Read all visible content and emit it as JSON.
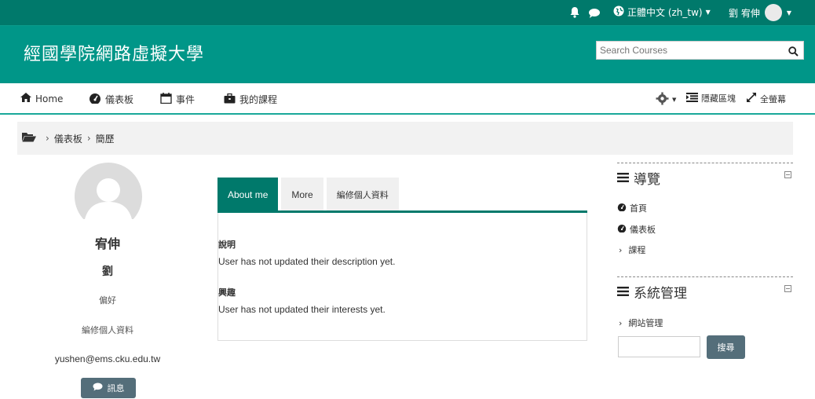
{
  "topbar": {
    "language": "正體中文 (zh_tw)",
    "user_name": "劉 宥伸"
  },
  "header": {
    "site_title": "經國學院網路虛擬大學",
    "search_placeholder": "Search Courses"
  },
  "nav": {
    "home": "Home",
    "dashboard": "儀表板",
    "events": "事件",
    "my_courses": "我的課程",
    "hide_blocks": "隱藏區塊",
    "fullscreen": "全螢幕"
  },
  "breadcrumb": {
    "items": [
      "儀表板",
      "簡歷"
    ]
  },
  "profile": {
    "first_name": "宥伸",
    "last_name": "劉",
    "preferences": "偏好",
    "edit_profile": "編修個人資料",
    "email": "yushen@ems.cku.edu.tw",
    "message_button": "訊息"
  },
  "tabs": [
    {
      "label": "About me",
      "active": true
    },
    {
      "label": "More",
      "active": false
    },
    {
      "label": "編修個人資料",
      "active": false
    }
  ],
  "about": {
    "description_title": "說明",
    "description_text": "User has not updated their description yet.",
    "interests_title": "興趣",
    "interests_text": "User has not updated their interests yet."
  },
  "navigation_block": {
    "title": "導覽",
    "items": [
      "首頁",
      "儀表板",
      "課程"
    ]
  },
  "admin_block": {
    "title": "系統管理",
    "items": [
      "網站管理"
    ],
    "search_button": "搜尋"
  },
  "colors": {
    "topbar": "#00796b",
    "header": "#009688",
    "accent": "#00796b",
    "button": "#546e7a"
  }
}
